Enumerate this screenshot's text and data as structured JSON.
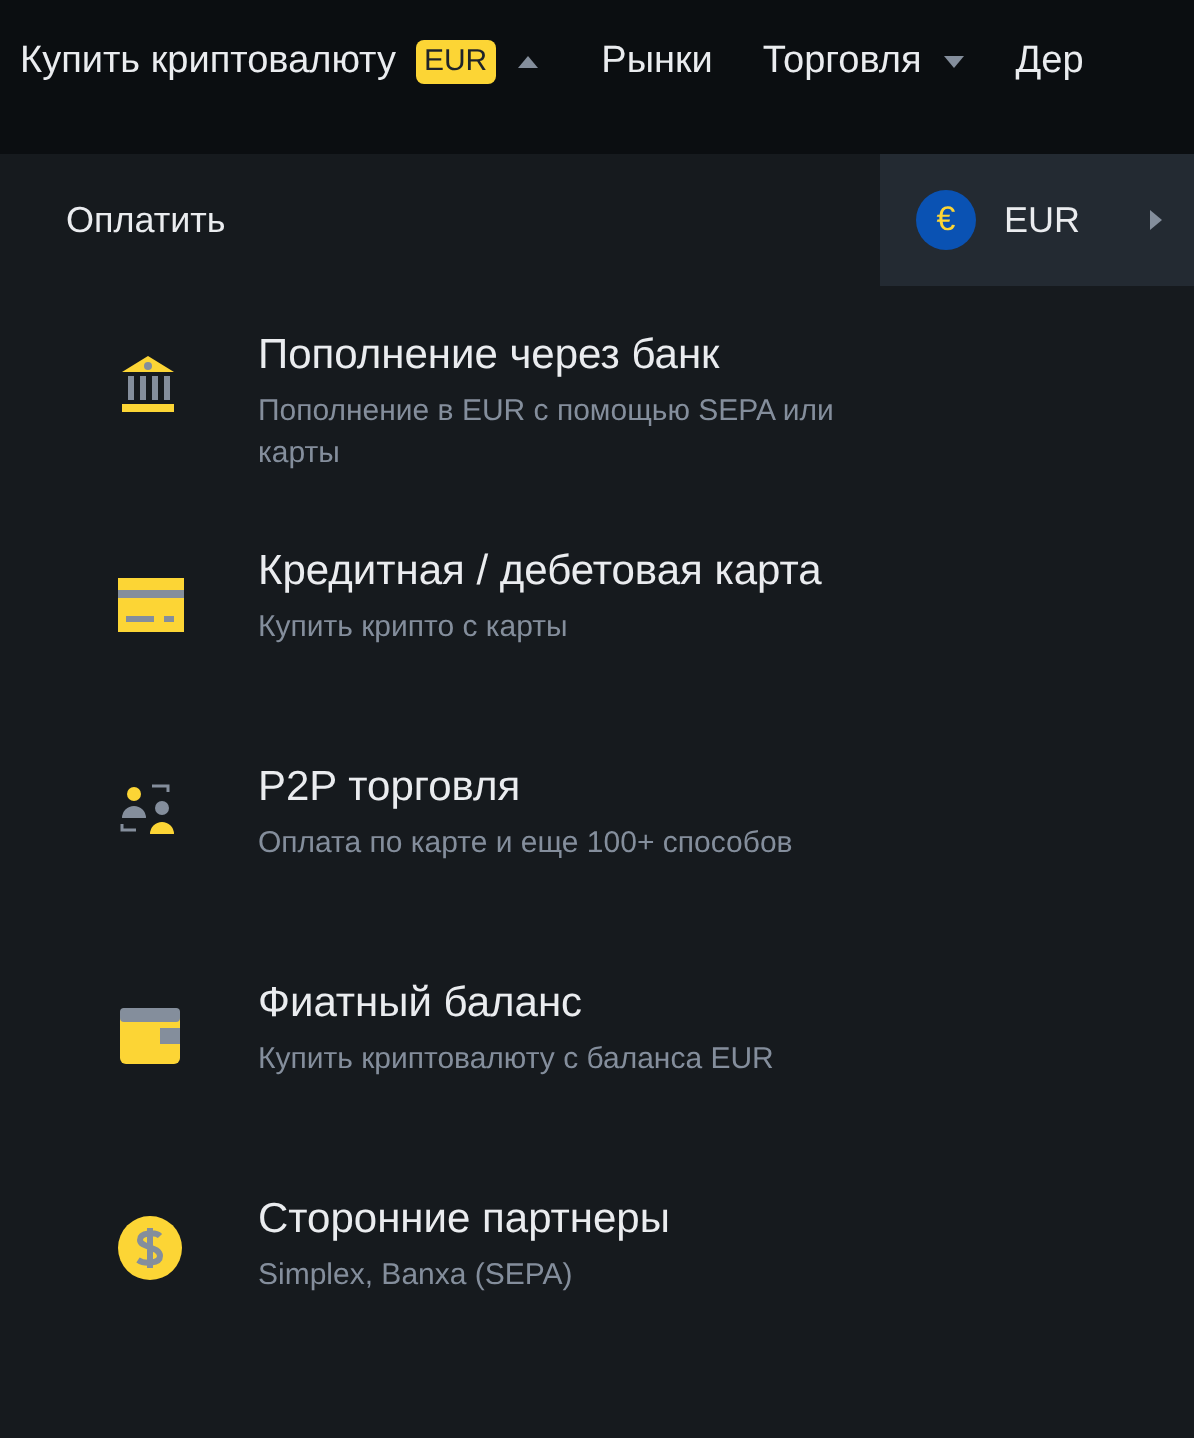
{
  "nav": [
    {
      "label": "Купить криптовалюту",
      "badge": "EUR",
      "expanded": true
    },
    {
      "label": "Рынки"
    },
    {
      "label": "Торговля",
      "expanded": false
    },
    {
      "label": "Дер"
    }
  ],
  "pay_label": "Оплатить",
  "currency": {
    "code": "EUR",
    "symbol": "€"
  },
  "methods": [
    {
      "kind": "bank",
      "title": "Пополнение через банк",
      "subtitle": "Пополнение в EUR с помощью SEPA или карты"
    },
    {
      "kind": "card",
      "title": "Кредитная / дебетовая карта",
      "subtitle": "Купить крипто с карты"
    },
    {
      "kind": "p2p",
      "title": "P2P торговля",
      "subtitle": "Оплата по карте и еще 100+ способов"
    },
    {
      "kind": "wallet",
      "title": "Фиатный баланс",
      "subtitle": "Купить криптовалюту с баланса EUR"
    },
    {
      "kind": "dollar",
      "title": "Сторонние партнеры",
      "subtitle": "Simplex, Banxa (SEPA)"
    }
  ]
}
